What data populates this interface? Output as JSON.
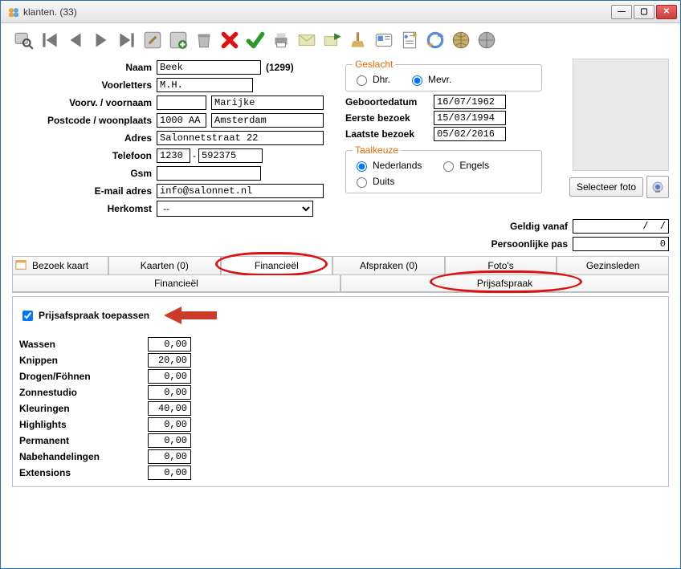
{
  "window": {
    "title": "klanten.  (33)"
  },
  "toolbar_icons": [
    "search",
    "first",
    "prev",
    "next",
    "last",
    "edit",
    "new",
    "trash",
    "delete",
    "ok",
    "print",
    "mail",
    "send",
    "clean",
    "card",
    "report",
    "sync",
    "web",
    "globe"
  ],
  "form": {
    "labels": {
      "naam": "Naam",
      "voorletters": "Voorletters",
      "voorv": "Voorv. / voornaam",
      "postcode": "Postcode / woonplaats",
      "adres": "Adres",
      "telefoon": "Telefoon",
      "gsm": "Gsm",
      "email": "E-mail adres",
      "herkomst": "Herkomst"
    },
    "values": {
      "naam": "Beek",
      "id": "(1299)",
      "voorletters": "M.H.",
      "voorv": "",
      "voornaam": "Marijke",
      "postcode": "1000 AA",
      "plaats": "Amsterdam",
      "adres": "Salonnetstraat 22",
      "tel_a": "1230",
      "tel_b": "592375",
      "gsm": "",
      "email": "info@salonnet.nl",
      "herkomst": "--"
    }
  },
  "geslacht": {
    "legend": "Geslacht",
    "dhr": "Dhr.",
    "mevr": "Mevr.",
    "selected": "mevr"
  },
  "dates": {
    "geboortedatum_l": "Geboortedatum",
    "geboortedatum": "16/07/1962",
    "eerste_l": "Eerste bezoek",
    "eerste": "15/03/1994",
    "laatste_l": "Laatste bezoek",
    "laatste": "05/02/2016"
  },
  "taal": {
    "legend": "Taalkeuze",
    "nl": "Nederlands",
    "en": "Engels",
    "du": "Duits",
    "selected": "nl"
  },
  "photo": {
    "select_label": "Selecteer foto"
  },
  "validity": {
    "geldig_l": "Geldig vanaf",
    "geldig": "/  /",
    "pas_l": "Persoonlijke pas",
    "pas": "0"
  },
  "tabs": {
    "bezoek": "Bezoek kaart",
    "kaarten": "Kaarten (0)",
    "financieel": "Financieël",
    "afspraken": "Afspraken (0)",
    "fotos": "Foto's",
    "gezin": "Gezinsleden"
  },
  "subtabs": {
    "financieel": "Financieël",
    "prijs": "Prijsafspraak"
  },
  "pricing": {
    "checkbox_label": "Prijsafspraak toepassen",
    "items": [
      {
        "label": "Wassen",
        "value": "0,00"
      },
      {
        "label": "Knippen",
        "value": "20,00"
      },
      {
        "label": "Drogen/Föhnen",
        "value": "0,00"
      },
      {
        "label": "Zonnestudio",
        "value": "0,00"
      },
      {
        "label": "Kleuringen",
        "value": "40,00"
      },
      {
        "label": "Highlights",
        "value": "0,00"
      },
      {
        "label": "Permanent",
        "value": "0,00"
      },
      {
        "label": "Nabehandelingen",
        "value": "0,00"
      },
      {
        "label": "Extensions",
        "value": "0,00"
      }
    ]
  }
}
